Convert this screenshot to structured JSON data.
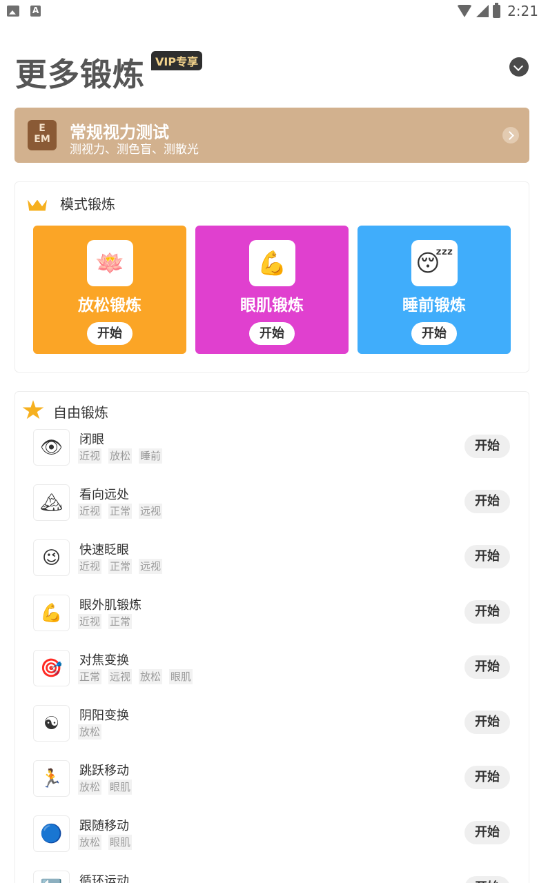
{
  "status_bar": {
    "time": "2:21",
    "icons": [
      "image-icon",
      "font-icon",
      "wifi-icon",
      "cellular-icon",
      "battery-icon"
    ]
  },
  "header": {
    "title": "更多锻炼",
    "vip_badge": "VIP专享"
  },
  "vision_test": {
    "icon_text": "E\nEM",
    "title": "常规视力测试",
    "subtitle": "测视力、测色盲、测散光"
  },
  "mode_section": {
    "title": "模式锻炼",
    "cards": [
      {
        "name": "放松锻炼",
        "start": "开始",
        "color": "#fba526",
        "icon": "🪷"
      },
      {
        "name": "眼肌锻炼",
        "start": "开始",
        "color": "#e040cf",
        "icon": "💪"
      },
      {
        "name": "睡前锻炼",
        "start": "开始",
        "color": "#40adfb",
        "icon": "😴"
      }
    ]
  },
  "free_section": {
    "title": "自由锻炼",
    "items": [
      {
        "name": "闭眼",
        "tags": [
          "近视",
          "放松",
          "睡前"
        ],
        "start": "开始",
        "icon": "👁"
      },
      {
        "name": "看向远处",
        "tags": [
          "近视",
          "正常",
          "远视"
        ],
        "start": "开始",
        "icon": "🏔"
      },
      {
        "name": "快速眨眼",
        "tags": [
          "近视",
          "正常",
          "远视"
        ],
        "start": "开始",
        "icon": "😉"
      },
      {
        "name": "眼外肌锻炼",
        "tags": [
          "近视",
          "正常"
        ],
        "start": "开始",
        "icon": "💪"
      },
      {
        "name": "对焦变换",
        "tags": [
          "正常",
          "远视",
          "放松",
          "眼肌"
        ],
        "start": "开始",
        "icon": "🎯"
      },
      {
        "name": "阴阳变换",
        "tags": [
          "放松"
        ],
        "start": "开始",
        "icon": "☯"
      },
      {
        "name": "跳跃移动",
        "tags": [
          "放松",
          "眼肌"
        ],
        "start": "开始",
        "icon": "🏃"
      },
      {
        "name": "跟随移动",
        "tags": [
          "放松",
          "眼肌"
        ],
        "start": "开始",
        "icon": "🔵"
      },
      {
        "name": "循环运动",
        "tags": [],
        "start": "开始",
        "icon": "🔄"
      }
    ]
  }
}
